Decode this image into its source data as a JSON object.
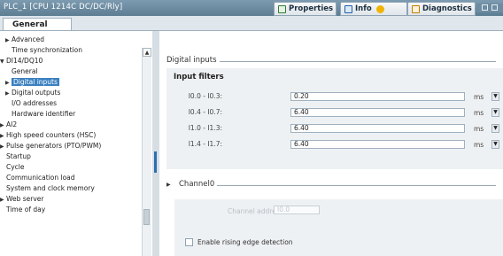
{
  "titlebar": {
    "title": "PLC_1 [CPU 1214C DC/DC/Rly]",
    "tabs": [
      {
        "label": "Properties",
        "icon": "properties-icon",
        "color": "#2e7d32"
      },
      {
        "label": "Info",
        "icon": "info-icon",
        "color": "#1e5fa8"
      },
      {
        "label": "Diagnostics",
        "icon": "diagnostics-icon",
        "color": "#c77b00"
      }
    ]
  },
  "tabbar": {
    "general_label": "General"
  },
  "tree": {
    "items": [
      {
        "label": "Advanced",
        "arrow": "▶"
      },
      {
        "label": "Time synchronization",
        "arrow": ""
      },
      {
        "label": "DI14/DQ10",
        "arrow": "▼"
      },
      {
        "label": "General",
        "arrow": ""
      },
      {
        "label": "Digital inputs",
        "arrow": "▶"
      },
      {
        "label": "Digital outputs",
        "arrow": "▶"
      },
      {
        "label": "I/O addresses",
        "arrow": ""
      },
      {
        "label": "Hardware identifier",
        "arrow": ""
      },
      {
        "label": "AI2",
        "arrow": "▶"
      },
      {
        "label": "High speed counters (HSC)",
        "arrow": "▶"
      },
      {
        "label": "Pulse generators (PTO/PWM)",
        "arrow": "▶"
      },
      {
        "label": "Startup",
        "arrow": ""
      },
      {
        "label": "Cycle",
        "arrow": ""
      },
      {
        "label": "Communication load",
        "arrow": ""
      },
      {
        "label": "System and clock memory",
        "arrow": ""
      },
      {
        "label": "Web server",
        "arrow": "▶"
      },
      {
        "label": "Time of day",
        "arrow": ""
      }
    ]
  },
  "content": {
    "section_title": "Digital inputs",
    "filters_header": "Input filters",
    "filters": [
      {
        "label": "I0.0 - I0.3:",
        "value": "0.20",
        "unit": "ms"
      },
      {
        "label": "I0.4 - I0.7:",
        "value": "6.40",
        "unit": "ms"
      },
      {
        "label": "I1.0 - I1.3:",
        "value": "6.40",
        "unit": "ms"
      },
      {
        "label": "I1.4 - I1.7:",
        "value": "6.40",
        "unit": "ms"
      }
    ],
    "channel_title": "Channel0",
    "channel_address_label": "Channel address:",
    "channel_address_value": "I0.0",
    "rising_edge_label": "Enable rising edge detection"
  }
}
